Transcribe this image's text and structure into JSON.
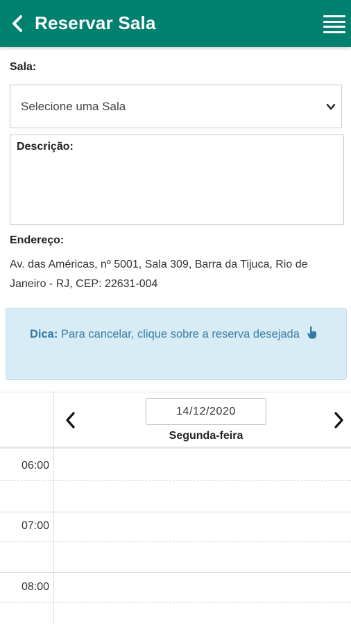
{
  "header": {
    "title": "Reservar Sala",
    "back_icon": "chevron-left-icon",
    "menu_icon": "hamburger-menu-icon",
    "background_color": "#00806f"
  },
  "form": {
    "room_label": "Sala:",
    "room_select_value": "Selecione uma Sala",
    "description_label": "Descrição:",
    "address_label": "Endereço:",
    "address_text": "Av. das Américas, nº 5001, Sala 309, Barra da Tijuca, Rio de Janeiro - RJ, CEP: 22631-004"
  },
  "tip": {
    "label": "Dica:",
    "text": "Para cancelar, clique sobre a reserva desejada",
    "icon": "pointing-hand-icon",
    "background_color": "#d8ecf6"
  },
  "calendar": {
    "date_value": "14/12/2020",
    "weekday": "Segunda-feira",
    "prev_icon": "chevron-left-icon",
    "next_icon": "chevron-right-icon",
    "hours": [
      "06:00",
      "07:00",
      "08:00"
    ]
  }
}
